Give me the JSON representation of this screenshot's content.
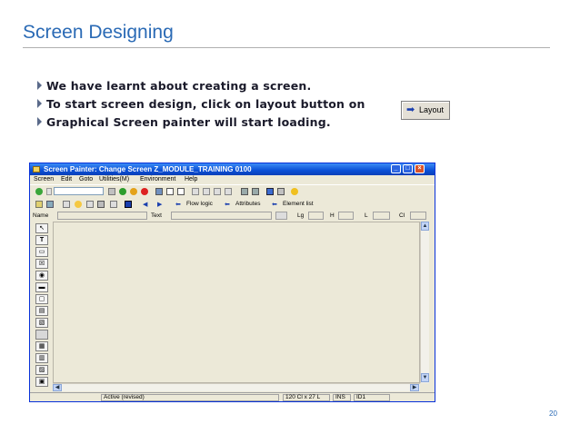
{
  "slide": {
    "title": "Screen Designing",
    "bullets": [
      "We have learnt about creating a screen.",
      "To start screen design, click on layout button on",
      "Graphical Screen painter will start loading."
    ],
    "layout_button_label": "Layout",
    "page_number": "20"
  },
  "window": {
    "title": "Screen Painter:  Change Screen Z_MODULE_TRAINING 0100",
    "menu": [
      "Screen",
      "Edit",
      "Goto",
      "Utilities(M)",
      "Environment",
      "Help"
    ],
    "toolbar2": {
      "flow_logic": "Flow logic",
      "attributes": "Attributes",
      "element_list": "Element list"
    },
    "fields": {
      "name": "Name",
      "text": "Text",
      "lg": "Lg",
      "h": "H",
      "l": "L",
      "cl": "Cl"
    },
    "status": {
      "mode": "Active (revised)",
      "size": "120 Cl x 27 L",
      "ins": "INS",
      "server": "ID1"
    }
  },
  "colors": {
    "title_blue": "#2a6ab5",
    "xp_titlebar": "#0a4fd6",
    "window_bg": "#ece9d8"
  }
}
